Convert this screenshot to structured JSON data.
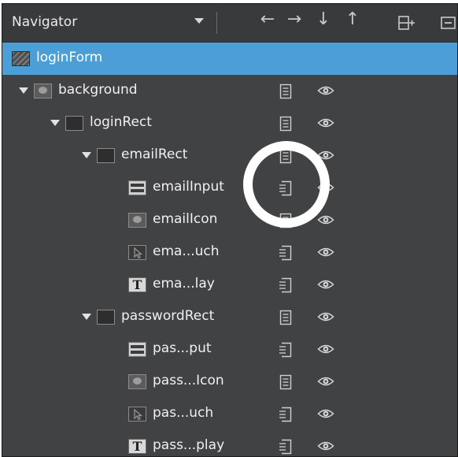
{
  "navigator": {
    "title": "Navigator",
    "toolbar": [
      {
        "icon": "arrow-left-icon",
        "glyph": "←"
      },
      {
        "icon": "arrow-right-icon",
        "glyph": "→"
      },
      {
        "icon": "arrow-down-icon",
        "glyph": "↓"
      },
      {
        "icon": "arrow-up-icon",
        "glyph": "↑"
      }
    ]
  },
  "tree": [
    {
      "label": "loginForm",
      "type": "form",
      "indent": 0,
      "expanded": null,
      "selected": true,
      "lock": false,
      "eye": false
    },
    {
      "label": "background",
      "type": "image",
      "indent": 0,
      "expanded": true,
      "selected": false,
      "lock": true,
      "eye": true
    },
    {
      "label": "loginRect",
      "type": "rect",
      "indent": 1,
      "expanded": true,
      "selected": false,
      "lock": true,
      "eye": true
    },
    {
      "label": "emailRect",
      "type": "rect",
      "indent": 2,
      "expanded": true,
      "selected": false,
      "lock": true,
      "eye": true
    },
    {
      "label": "emailInput",
      "type": "input",
      "indent": 3,
      "expanded": null,
      "selected": false,
      "lock": true,
      "eye": true
    },
    {
      "label": "emailIcon",
      "type": "image",
      "indent": 3,
      "expanded": null,
      "selected": false,
      "lock": true,
      "eye": true
    },
    {
      "label": "ema...uch",
      "type": "touch",
      "indent": 3,
      "expanded": null,
      "selected": false,
      "lock": true,
      "eye": true
    },
    {
      "label": "ema...lay",
      "type": "text",
      "indent": 3,
      "expanded": null,
      "selected": false,
      "lock": true,
      "eye": true
    },
    {
      "label": "passwordRect",
      "type": "rect",
      "indent": 2,
      "expanded": true,
      "selected": false,
      "lock": true,
      "eye": true
    },
    {
      "label": "pas...put",
      "type": "input",
      "indent": 3,
      "expanded": null,
      "selected": false,
      "lock": true,
      "eye": true
    },
    {
      "label": "pass...Icon",
      "type": "image",
      "indent": 3,
      "expanded": null,
      "selected": false,
      "lock": true,
      "eye": true
    },
    {
      "label": "pas...uch",
      "type": "touch",
      "indent": 3,
      "expanded": null,
      "selected": false,
      "lock": true,
      "eye": true
    },
    {
      "label": "pass...play",
      "type": "text",
      "indent": 3,
      "expanded": null,
      "selected": false,
      "lock": true,
      "eye": true
    }
  ],
  "text_icon_glyph": "T",
  "colors": {
    "panel": "#404244",
    "selection": "#4b9fd6",
    "highlight_ring": "#ffffff"
  }
}
